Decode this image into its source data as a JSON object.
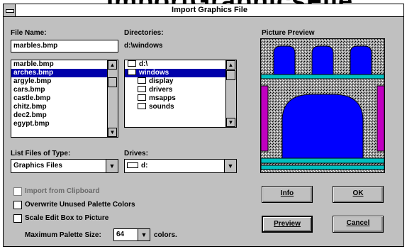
{
  "background_title": "ImportGraphicsFile",
  "dialog": {
    "title": "Import Graphics File"
  },
  "file_name": {
    "label": "File Name:",
    "value": "marbles.bmp",
    "files": [
      "marble.bmp",
      "arches.bmp",
      "argyle.bmp",
      "cars.bmp",
      "castle.bmp",
      "chitz.bmp",
      "dec2.bmp",
      "egypt.bmp"
    ],
    "selected_index": 1
  },
  "directories": {
    "label": "Directories:",
    "path": "d:\\windows",
    "items": [
      "d:\\",
      "windows",
      "display",
      "drivers",
      "msapps",
      "sounds"
    ],
    "selected_index": 1
  },
  "list_files_type": {
    "label": "List Files of Type:",
    "value": "Graphics Files"
  },
  "drives": {
    "label": "Drives:",
    "value": "d:"
  },
  "picture_preview": {
    "label": "Picture Preview",
    "colors": {
      "blue": "#0000ff",
      "cyan": "#00c0c0",
      "magenta": "#c000c0",
      "granite": "#9a9a9a"
    }
  },
  "options": {
    "import_clipboard": "Import from Clipboard",
    "overwrite_palette": "Overwrite Unused Palette Colors",
    "scale_edit_box": "Scale Edit Box to Picture",
    "max_palette_label": "Maximum Palette Size:",
    "max_palette_value": "64",
    "colors_suffix": "colors."
  },
  "buttons": {
    "info": "Info",
    "ok": "OK",
    "preview": "Preview",
    "cancel": "Cancel"
  }
}
